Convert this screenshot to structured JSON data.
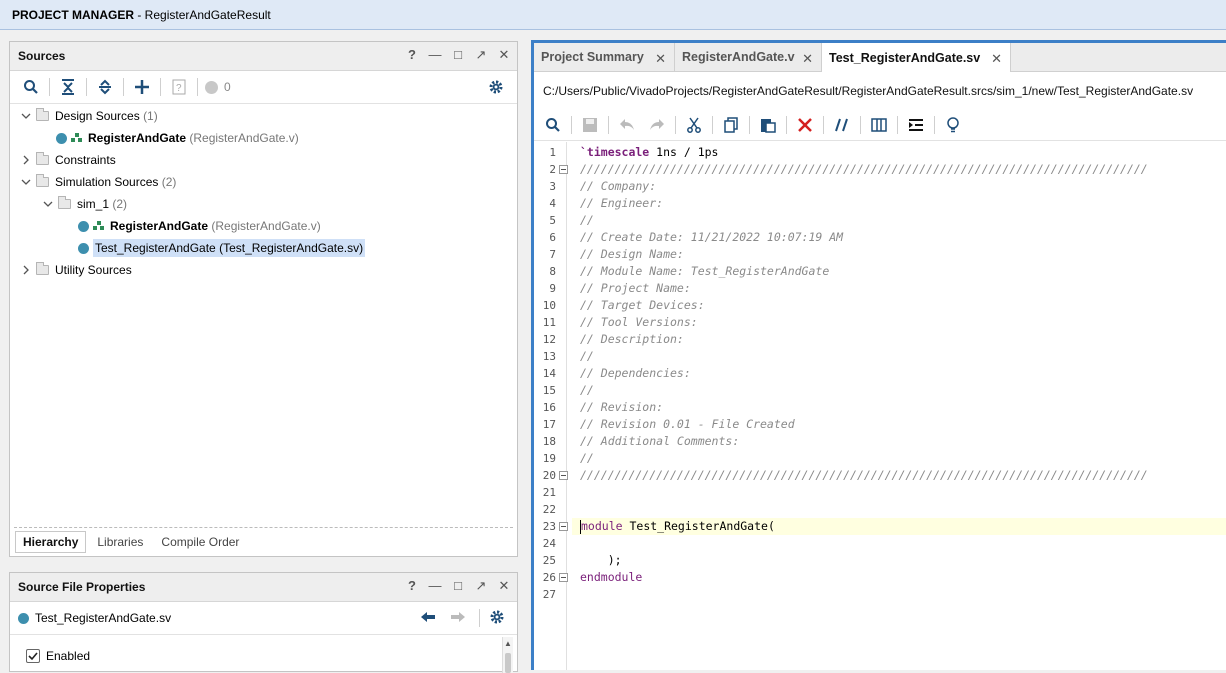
{
  "window": {
    "title_bold": "PROJECT MANAGER",
    "title_rest": " - RegisterAndGateResult"
  },
  "sources_panel": {
    "title": "Sources",
    "count_badge": "0",
    "tree": [
      {
        "label": "Design Sources",
        "count": "(1)"
      },
      {
        "label": "RegisterAndGate",
        "meta": "(RegisterAndGate.v)"
      },
      {
        "label": "Constraints"
      },
      {
        "label": "Simulation Sources",
        "count": "(2)"
      },
      {
        "label": "sim_1",
        "count": "(2)"
      },
      {
        "label": "RegisterAndGate",
        "meta": "(RegisterAndGate.v)"
      },
      {
        "label": "Test_RegisterAndGate (Test_RegisterAndGate.sv)"
      },
      {
        "label": "Utility Sources"
      }
    ],
    "tabs": [
      "Hierarchy",
      "Libraries",
      "Compile Order"
    ]
  },
  "properties_panel": {
    "title": "Source File Properties",
    "file": "Test_RegisterAndGate.sv",
    "enabled_label": "Enabled"
  },
  "editor": {
    "tabs": [
      "Project Summary",
      "RegisterAndGate.v",
      "Test_RegisterAndGate.sv"
    ],
    "path": "C:/Users/Public/VivadoProjects/RegisterAndGateResult/RegisterAndGateResult.srcs/sim_1/new/Test_RegisterAndGate.sv",
    "lines": [
      "`timescale 1ns / 1ps",
      "//////////////////////////////////////////////////////////////////////////////////",
      "// Company:",
      "// Engineer:",
      "//",
      "// Create Date: 11/21/2022 10:07:19 AM",
      "// Design Name:",
      "// Module Name: Test_RegisterAndGate",
      "// Project Name:",
      "// Target Devices:",
      "// Tool Versions:",
      "// Description:",
      "//",
      "// Dependencies:",
      "//",
      "// Revision:",
      "// Revision 0.01 - File Created",
      "// Additional Comments:",
      "//",
      "//////////////////////////////////////////////////////////////////////////////////",
      "",
      "",
      "module Test_RegisterAndGate(",
      "",
      "    );",
      "endmodule",
      ""
    ],
    "line_numbers": [
      "1",
      "2",
      "3",
      "4",
      "5",
      "6",
      "7",
      "8",
      "9",
      "10",
      "11",
      "12",
      "13",
      "14",
      "15",
      "16",
      "17",
      "18",
      "19",
      "20",
      "21",
      "22",
      "23",
      "24",
      "25",
      "26",
      "27"
    ]
  }
}
